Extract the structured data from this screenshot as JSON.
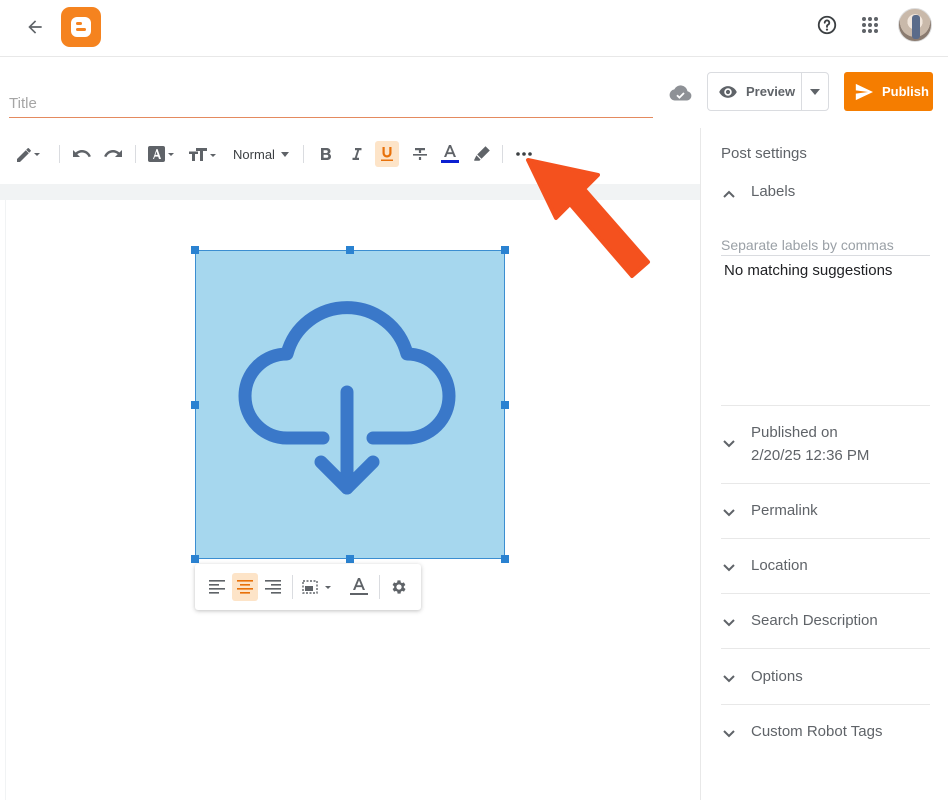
{
  "header": {
    "back_icon": "arrow-left-icon",
    "logo_icon": "blogger-logo",
    "help_icon": "help-circle-icon",
    "apps_icon": "apps-grid-icon"
  },
  "editor_header": {
    "title_placeholder": "Title",
    "title_value": "",
    "preview_label": "Preview",
    "publish_label": "Publish"
  },
  "toolbar": {
    "paragraph_style": "Normal",
    "underline_active": true
  },
  "image_toolbar": {
    "center_align_active": true
  },
  "sidebar": {
    "title": "Post settings",
    "labels": {
      "header": "Labels",
      "placeholder": "Separate labels by commas",
      "suggestion": "No matching suggestions"
    },
    "published": {
      "header": "Published on",
      "date": "2/20/25 12:36 PM"
    },
    "sections": [
      "Permalink",
      "Location",
      "Search Description",
      "Options",
      "Custom Robot Tags"
    ]
  },
  "colors": {
    "accent": "#f57d00",
    "image_fill": "#a6d7ee",
    "cloud_icon": "#3a78c9",
    "arrow": "#f4511e"
  }
}
